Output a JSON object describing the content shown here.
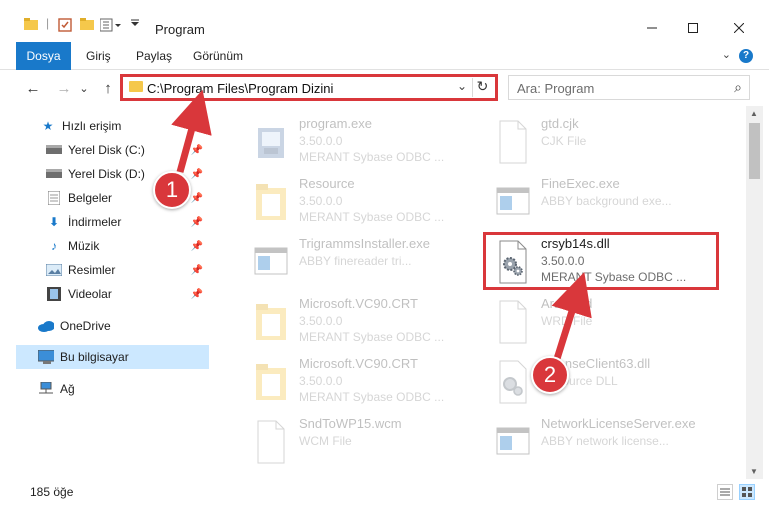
{
  "window": {
    "title": "Program"
  },
  "ribbon": {
    "tabs": [
      "Dosya",
      "Giriş",
      "Paylaş",
      "Görünüm"
    ],
    "help": "?"
  },
  "nav": {
    "back": "←",
    "forward": "→",
    "recent": "⌄",
    "up": "↑"
  },
  "address": {
    "path": "C:\\Program Files\\Program Dizini"
  },
  "search": {
    "placeholder": "Ara: Program"
  },
  "sidebar": {
    "items": [
      {
        "label": "Hızlı erişim",
        "icon": "star-icon"
      },
      {
        "label": "Yerel Disk (C:)",
        "icon": "drive-icon",
        "pinned": true
      },
      {
        "label": "Yerel Disk (D:)",
        "icon": "drive-icon",
        "pinned": true
      },
      {
        "label": "Belgeler",
        "icon": "documents-icon",
        "pinned": true
      },
      {
        "label": "İndirmeler",
        "icon": "download-icon",
        "pinned": true
      },
      {
        "label": "Müzik",
        "icon": "music-icon",
        "pinned": true
      },
      {
        "label": "Resimler",
        "icon": "pictures-icon",
        "pinned": true
      },
      {
        "label": "Videolar",
        "icon": "videos-icon",
        "pinned": true
      },
      {
        "label": "OneDrive",
        "icon": "cloud-icon"
      },
      {
        "label": "Bu bilgisayar",
        "icon": "computer-icon",
        "selected": true
      },
      {
        "label": "Ağ",
        "icon": "network-icon"
      }
    ]
  },
  "files": [
    {
      "name": "program.exe",
      "version": "3.50.0.0",
      "desc": "MERANT Sybase ODBC ...",
      "type": "exe-icon"
    },
    {
      "name": "gtd.cjk",
      "version": "CJK File",
      "desc": "",
      "type": "blank-file-icon"
    },
    {
      "name": "Resource",
      "version": "3.50.0.0",
      "desc": "MERANT Sybase ODBC ...",
      "type": "folder-icon"
    },
    {
      "name": "FineExec.exe",
      "version": "ABBY background exe...",
      "desc": "",
      "type": "app-window-icon"
    },
    {
      "name": "TrigrammsInstaller.exe",
      "version": "ABBY finereader tri...",
      "desc": "",
      "type": "app-window-icon"
    },
    {
      "name": "crsyb14s.dll",
      "version": "3.50.0.0",
      "desc": "MERANT Sybase ODBC ...",
      "type": "dll-gear-icon"
    },
    {
      "name": "Microsoft.VC90.CRT",
      "version": "3.50.0.0",
      "desc": "MERANT Sybase ODBC ...",
      "type": "folder-icon"
    },
    {
      "name": "ArabicLd",
      "version": "WRD File",
      "desc": "",
      "type": "blank-file-icon"
    },
    {
      "name": "Microsoft.VC90.CRT",
      "version": "3.50.0.0",
      "desc": "MERANT Sybase ODBC ...",
      "type": "folder-icon"
    },
    {
      "name": "LicenseClient63.dll",
      "version": "Resource DLL",
      "desc": "",
      "type": "dll-gear-icon"
    },
    {
      "name": "SndToWP15.wcm",
      "version": "WCM File",
      "desc": "",
      "type": "blank-file-icon"
    },
    {
      "name": "NetworkLicenseServer.exe",
      "version": "ABBY network license...",
      "desc": "",
      "type": "app-window-icon"
    }
  ],
  "status": {
    "count": "185 öğe"
  },
  "annotations": {
    "step1": "1",
    "step2": "2"
  },
  "colors": {
    "accent": "#1979ca",
    "highlight": "#d9373b",
    "selected_bg": "#cce8ff"
  }
}
